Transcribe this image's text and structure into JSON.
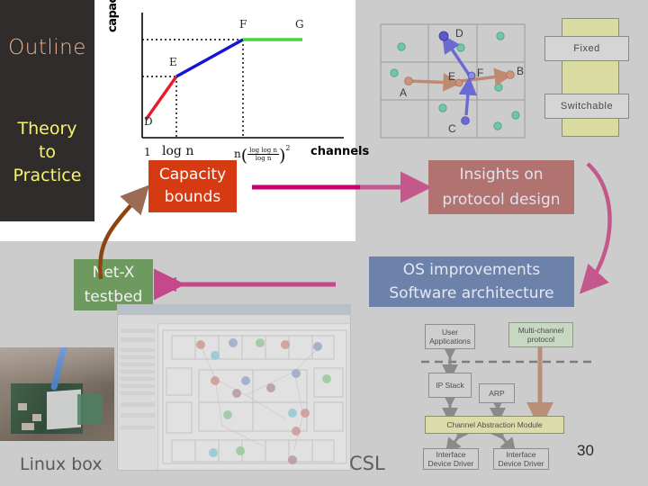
{
  "slide": {
    "page_number": "30",
    "background": "#cccccc",
    "white_panel": "#ffffff"
  },
  "sidebar": {
    "title": "Outline",
    "title_color": "#f0b391",
    "subtitle_lines": [
      "Theory",
      "to",
      "Practice"
    ],
    "subtitle_color": "#f7f36a",
    "background": "#2f2c2b"
  },
  "chart_data": {
    "type": "line",
    "title": "",
    "xlabel": "channels",
    "ylabel": "capacity",
    "grid": false,
    "legend": null,
    "x_ticks": [
      "1",
      "log n",
      "n ( log log n / log n )^2"
    ],
    "point_labels": [
      "D",
      "E",
      "F",
      "G"
    ],
    "series": [
      {
        "name": "segment-D-E",
        "color": "#e8192c",
        "x": [
          0.03,
          0.3
        ],
        "y": [
          0.13,
          0.48
        ]
      },
      {
        "name": "segment-E-F",
        "color": "#1414d8",
        "x": [
          0.3,
          0.78
        ],
        "y": [
          0.48,
          0.8
        ]
      },
      {
        "name": "segment-F-G",
        "color": "#3fd63f",
        "x": [
          0.78,
          1.0
        ],
        "y": [
          0.8,
          0.8
        ]
      }
    ],
    "dashed_guides": [
      {
        "from": "y-axis",
        "to": "E",
        "y": 0.48
      },
      {
        "from": "y-axis",
        "to": "F",
        "y": 0.8
      },
      {
        "from": "x-axis",
        "to": "E",
        "x": 0.3
      },
      {
        "from": "x-axis",
        "to": "F",
        "x": 0.78
      }
    ],
    "x_axis_expression": {
      "tick1": "1",
      "tick2": "log n",
      "tick3_prefix": "n",
      "tick3_numerator": "log log n",
      "tick3_denominator": "log n",
      "tick3_exponent": "2",
      "tick3_suffix": "channels"
    }
  },
  "node_grid": {
    "rows": 3,
    "cols": 3,
    "node_labels": [
      "D",
      "F",
      "B",
      "A",
      "E",
      "C"
    ],
    "node_color": "#6fc6a8",
    "path_blue_color": "#6a6ad0",
    "path_brown_color": "#c08a72",
    "grid_line_color": "#9a9a9a"
  },
  "fixed_switchable": {
    "fixed_label": "Fixed",
    "switchable_label": "Switchable",
    "bar_color": "#d9dba0",
    "label_bg": "#d5d5d5"
  },
  "boxes": {
    "capacity": {
      "lines": [
        "Capacity",
        "bounds"
      ],
      "color": "#d63a12"
    },
    "insights": {
      "lines": [
        "Insights on",
        "protocol design"
      ],
      "color": "#b0736f"
    },
    "os": {
      "lines": [
        "OS improvements",
        "Software architecture"
      ],
      "color": "#6c82ab"
    },
    "netx": {
      "lines": [
        "Net-X",
        "testbed"
      ],
      "color": "#6f9a5f"
    }
  },
  "architecture": {
    "boxes": [
      {
        "id": "user-applications",
        "lines": [
          "User",
          "Applications"
        ],
        "style": "plain"
      },
      {
        "id": "multi-channel-protocol",
        "lines": [
          "Multi-channel",
          "protocol"
        ],
        "style": "green"
      },
      {
        "id": "ip-stack",
        "lines": [
          "IP Stack"
        ],
        "style": "plain"
      },
      {
        "id": "arp",
        "lines": [
          "ARP"
        ],
        "style": "plain"
      },
      {
        "id": "channel-abstraction-module",
        "lines": [
          "Channel Abstraction Module"
        ],
        "style": "olive"
      },
      {
        "id": "interface-device-driver-1",
        "lines": [
          "Interface",
          "Device Driver"
        ],
        "style": "plain"
      },
      {
        "id": "interface-device-driver-2",
        "lines": [
          "Interface",
          "Device Driver"
        ],
        "style": "plain"
      }
    ],
    "kernel_boundary": "dashed"
  },
  "captions": {
    "linux_box": "Linux box",
    "csl": "CSL"
  },
  "arrows": {
    "capacity_to_insights_color": "#c4006e",
    "os_to_netx_color": "#c44a86",
    "curve_brown_color": "#8a4512",
    "curve_pink_color": "#c4588c"
  }
}
